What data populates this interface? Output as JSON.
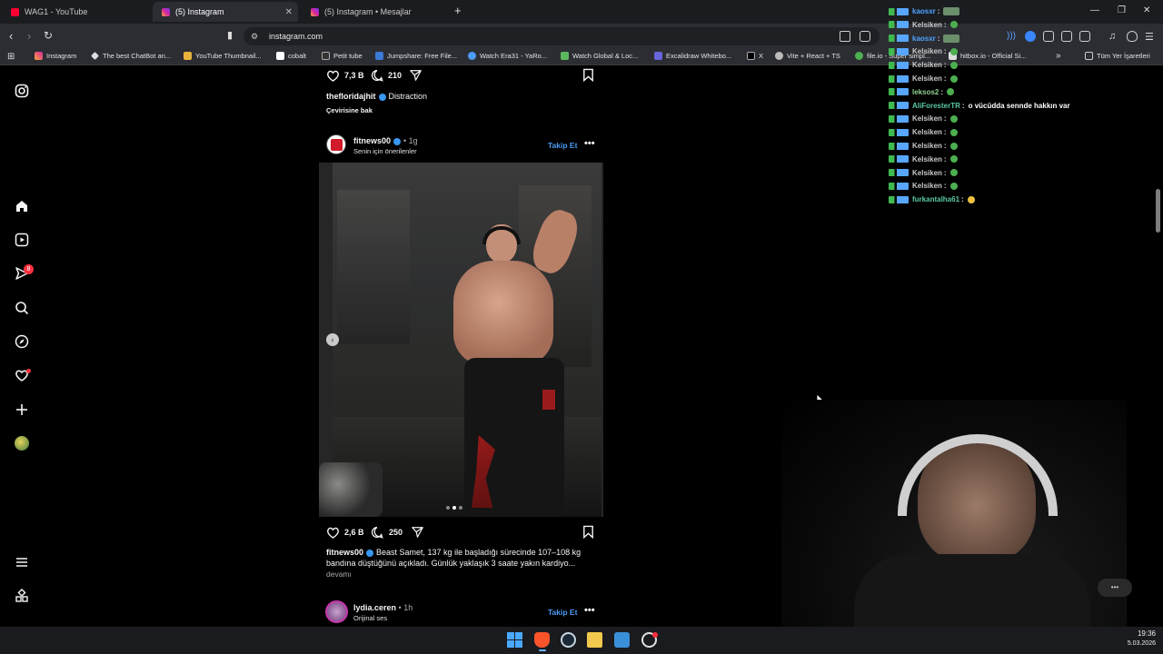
{
  "browser": {
    "tabs": [
      {
        "title": "WAG1 - YouTube",
        "favicon": "youtube-icon",
        "active": false
      },
      {
        "title": "(5) Instagram",
        "favicon": "instagram-icon",
        "active": true
      },
      {
        "title": "(5) Instagram • Mesajlar",
        "favicon": "instagram-icon",
        "active": false
      }
    ],
    "url": "instagram.com",
    "bookmarks": [
      "Instagram",
      "The best ChatBot an...",
      "YouTube Thumbnail...",
      "cobalt",
      "Petit tube",
      "Jumpshare: Free File...",
      "Watch Era31 - YaRo...",
      "Watch Global & Loc...",
      "Excalidraw Whitebo...",
      "X",
      "Vite + React + TS",
      "file.io - Super simpl...",
      "hitbox.io - Official Si..."
    ],
    "bookmarks_overflow": "»",
    "all_bookmarks": "Tüm Yer İşaretleri"
  },
  "post1": {
    "likes": "7,3 B",
    "comments": "210",
    "username": "thefloridajhit",
    "song": "Distraction",
    "translate": "Çevirisine bak"
  },
  "post2": {
    "username": "fitnews00",
    "time": "1g",
    "subtitle": "Senin için önerilenler",
    "follow": "Takip Et",
    "likes": "2,6 B",
    "comments": "250",
    "caption_user": "fitnews00",
    "caption_line1": "Beast Samet, 137 kg ile başladığı sürecinde 107–108 kg",
    "caption_line2": "bandına düştüğünü açıkladı. Günlük yaklaşık 3 saate yakın kardiyo...",
    "more": "devamı"
  },
  "post3": {
    "username": "lydia.ceren",
    "time": "1h",
    "subtitle": "Orijinal ses",
    "follow": "Takip Et"
  },
  "notifications": {
    "messages_badge": "8"
  },
  "chat": [
    {
      "user": "kaosxr",
      "msg": "",
      "color": "#4da3ff"
    },
    {
      "user": "Kelsiken",
      "msg": "",
      "color": "#c9c9c9"
    },
    {
      "user": "kaosxr",
      "msg": "",
      "color": "#4da3ff"
    },
    {
      "user": "Kelsiken",
      "msg": "",
      "color": "#c9c9c9"
    },
    {
      "user": "Kelsiken",
      "msg": "",
      "color": "#c9c9c9"
    },
    {
      "user": "Kelsiken",
      "msg": "",
      "color": "#c9c9c9"
    },
    {
      "user": "leksos2",
      "msg": "",
      "color": "#8fd18f"
    },
    {
      "user": "AliForesterTR",
      "msg": "o vücüdda sennde hakkın var",
      "color": "#5ac8a8"
    },
    {
      "user": "Kelsiken",
      "msg": "",
      "color": "#c9c9c9"
    },
    {
      "user": "Kelsiken",
      "msg": "",
      "color": "#c9c9c9"
    },
    {
      "user": "Kelsiken",
      "msg": "",
      "color": "#c9c9c9"
    },
    {
      "user": "Kelsiken",
      "msg": "",
      "color": "#c9c9c9"
    },
    {
      "user": "Kelsiken",
      "msg": "",
      "color": "#c9c9c9"
    },
    {
      "user": "Kelsiken",
      "msg": "",
      "color": "#c9c9c9"
    },
    {
      "user": "furkantalha61",
      "msg": "",
      "color": "#5ac8a8"
    }
  ],
  "taskbar": {
    "time": "19:36",
    "date": "5.03.2026"
  },
  "colors": {
    "accent": "#4a9cf7",
    "background": "#000000"
  }
}
